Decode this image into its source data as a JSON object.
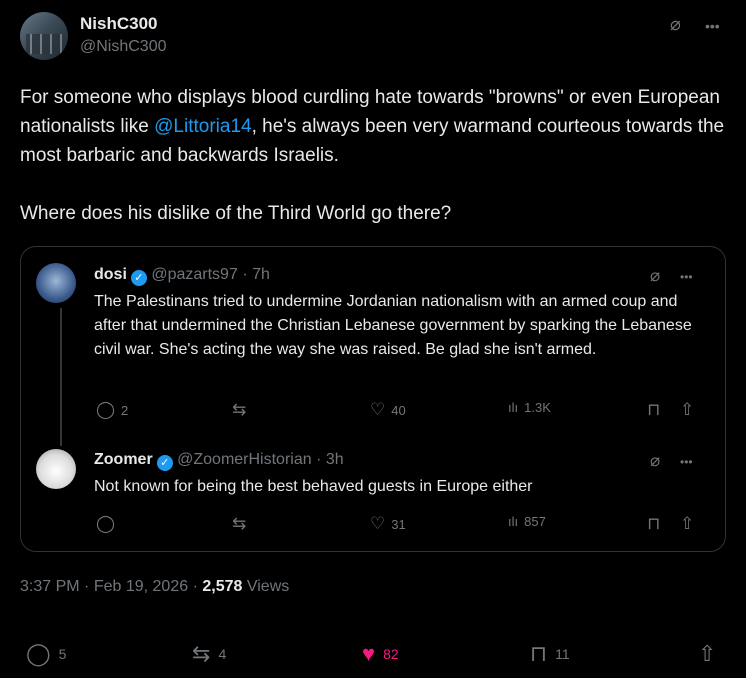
{
  "post": {
    "author_name": "NishC300",
    "author_handle": "@NishC300",
    "text_p1_a": "For someone who displays blood curdling hate towards \"browns\" or even European nationalists like ",
    "text_p1_mention": "@Littoria14",
    "text_p1_b": ", he's always been very warmand courteous towards the most barbaric and backwards Israelis.",
    "text_p2": "Where does his dislike of the Third World go there?",
    "time": "3:37 PM",
    "date": "Feb 19, 2026",
    "views_count": "2,578",
    "views_label": "Views",
    "sep": "·",
    "actions": {
      "replies": "5",
      "reposts": "4",
      "likes": "82",
      "bookmarks": "11"
    }
  },
  "quote": {
    "tweets": [
      {
        "name": "dosi",
        "handle": "@pazarts97",
        "time": "· 7h",
        "text": "The Palestinans tried to undermine Jordanian nationalism with an armed coup and after that undermined the Christian Lebanese government by sparking the Lebanese civil war. She's acting the way she was raised. Be glad she isn't armed.",
        "replies": "2",
        "likes": "40",
        "views": "1.3K"
      },
      {
        "name": "Zoomer",
        "handle": "@ZoomerHistorian",
        "time": "· 3h",
        "text": "Not known for being the best behaved guests in Europe either",
        "likes": "31",
        "views": "857"
      }
    ]
  },
  "icons": {
    "more": "•••",
    "grok": "⌀",
    "verified": "✓",
    "reply": "◯",
    "repost": "⇆",
    "like": "♡",
    "like_filled": "♥",
    "views": "ılı",
    "bookmark": "⊓",
    "share": "⇧"
  },
  "colors": {
    "accent": "#1d9bf0",
    "like_active": "#f91880",
    "muted": "#71767b",
    "text": "#e7e9ea",
    "background": "#000000",
    "border": "#2f3336"
  }
}
